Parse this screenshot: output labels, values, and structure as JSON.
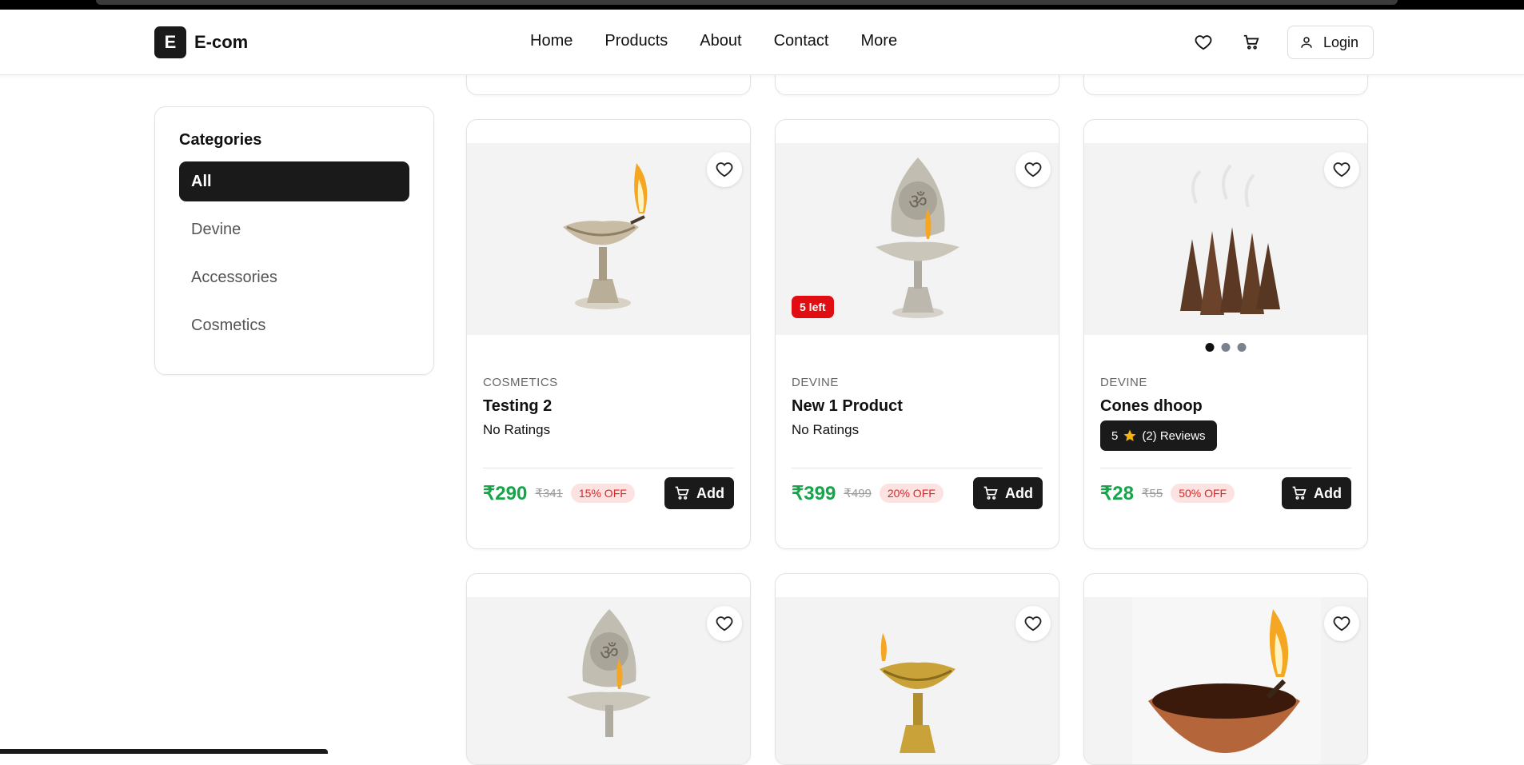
{
  "header": {
    "logo_letter": "E",
    "logo_text": "E-com",
    "nav": [
      "Home",
      "Products",
      "About",
      "Contact",
      "More"
    ],
    "login_label": "Login"
  },
  "sidebar": {
    "title": "Categories",
    "items": [
      {
        "label": "All",
        "active": true
      },
      {
        "label": "Devine",
        "active": false
      },
      {
        "label": "Accessories",
        "active": false
      },
      {
        "label": "Cosmetics",
        "active": false
      }
    ]
  },
  "products": [
    {
      "category": "COSMETICS",
      "name": "Testing 2",
      "rating": "No Ratings",
      "price": "₹290",
      "old_price": "₹341",
      "off": "15% OFF",
      "add": "Add",
      "image": "brass-diya"
    },
    {
      "category": "DEVINE",
      "name": "New 1 Product",
      "rating": "No Ratings",
      "price": "₹399",
      "old_price": "₹499",
      "off": "20% OFF",
      "add": "Add",
      "badge": "5 left",
      "image": "om-diya"
    },
    {
      "category": "DEVINE",
      "name": "Cones dhoop",
      "rating_score": "5",
      "rating_reviews": "(2) Reviews",
      "price": "₹28",
      "old_price": "₹55",
      "off": "50% OFF",
      "add": "Add",
      "image": "dhoop-cones"
    },
    {
      "image": "om-diya"
    },
    {
      "image": "gold-diya"
    },
    {
      "image": "clay-diya"
    }
  ],
  "colors": {
    "accent": "#1a1a1a",
    "price": "#16a34a",
    "discount": "#dc2626",
    "stock": "#e00d12"
  }
}
